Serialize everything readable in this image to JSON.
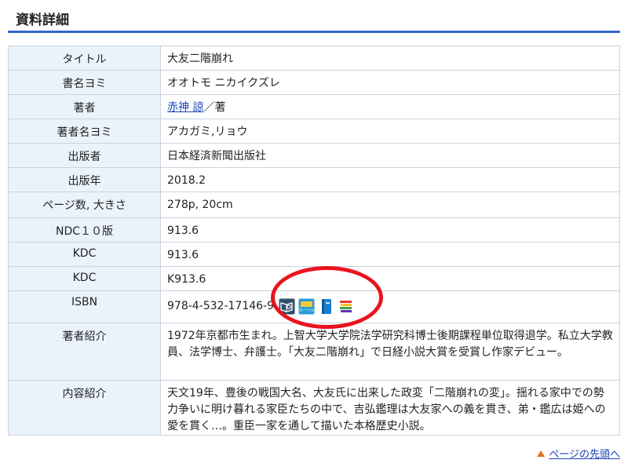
{
  "header": {
    "title": "資料詳細"
  },
  "rows": {
    "title": {
      "key": "タイトル",
      "value": "大友二階崩れ"
    },
    "title_reading": {
      "key": "書名ヨミ",
      "value": "オオトモ ニカイクズレ"
    },
    "author": {
      "key": "著者",
      "link": "赤神 諒",
      "suffix": "／著"
    },
    "author_reading": {
      "key": "著者名ヨミ",
      "value": "アカガミ,リョウ"
    },
    "publisher": {
      "key": "出版者",
      "value": "日本経済新聞出版社"
    },
    "year": {
      "key": "出版年",
      "value": "2018.2"
    },
    "pages": {
      "key": "ページ数, 大きさ",
      "value": "278p, 20cm"
    },
    "ndc10": {
      "key": "NDC１０版",
      "value": "913.6"
    },
    "kdc1": {
      "key": "KDC",
      "value": "913.6"
    },
    "kdc2": {
      "key": "KDC",
      "value": "K913.6"
    },
    "isbn": {
      "key": "ISBN",
      "value": "978-4-532-17146-9"
    },
    "author_bio": {
      "key": "著者紹介",
      "value": "1972年京都市生まれ。上智大学大学院法学研究科博士後期課程単位取得退学。私立大学教員、法学博士、弁護士。「大友二階崩れ」で日経小説大賞を受賞し作家デビュー。"
    },
    "summary": {
      "key": "内容紹介",
      "value": "天文19年、豊後の戦国大名、大友氏に出来した政変「二階崩れの変」。揺れる家中での勢力争いに明け暮れる家臣たちの中で、吉弘鑑理は大友家への義を貫き、弟・鑑広は姫への愛を貫く…。重臣一家を通して描いた本格歴史小説。"
    }
  },
  "isbn_icons": [
    "book-search-icon",
    "calil-icon",
    "blue-book-icon",
    "book-stack-icon"
  ],
  "calil_label": "カーリル",
  "footer": {
    "back_to_top": "ページの先頭へ"
  },
  "colors": {
    "accent": "#3366cc",
    "label_bg": "#eaf3fb",
    "highlight": "#e8141e",
    "link": "#1a44b8"
  }
}
